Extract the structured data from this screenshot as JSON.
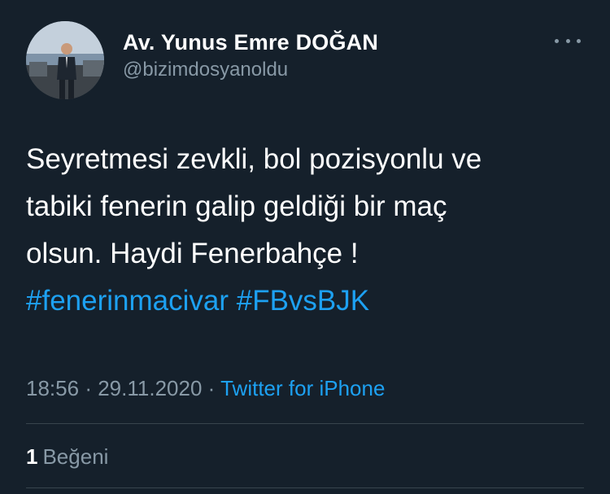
{
  "user": {
    "display_name": "Av. Yunus Emre DOĞAN",
    "handle": "@bizimdosyanoldu"
  },
  "icons": {
    "more": "more-horizontal-icon"
  },
  "tweet": {
    "text_lines": [
      "Seyretmesi zevkli, bol pozisyonlu ve",
      "tabiki fenerin galip geldiği bir maç",
      "olsun. Haydi Fenerbahçe !"
    ],
    "hashtags": [
      "#fenerinmacivar",
      "#FBvsBJK"
    ],
    "time": "18:56",
    "separator": "·",
    "date": "29.11.2020",
    "source": "Twitter for iPhone"
  },
  "stats": {
    "likes_count": "1",
    "likes_label": "Beğeni"
  },
  "colors": {
    "background": "#15202b",
    "accent": "#1da1f2",
    "secondary_text": "#8899a6",
    "divider": "#38444d"
  }
}
